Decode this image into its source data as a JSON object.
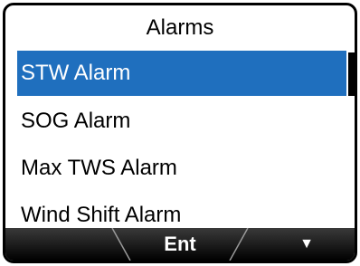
{
  "screen": {
    "title": "Alarms",
    "items": [
      {
        "label": "STW Alarm",
        "selected": true
      },
      {
        "label": "SOG Alarm",
        "selected": false
      },
      {
        "label": "Max TWS Alarm",
        "selected": false
      },
      {
        "label": "Wind Shift Alarm",
        "selected": false
      }
    ]
  },
  "softkeys": {
    "left": "",
    "center": "Ent",
    "right": "▼",
    "right_icon": "down-arrow-icon"
  },
  "colors": {
    "highlight": "#1f6fbe"
  }
}
